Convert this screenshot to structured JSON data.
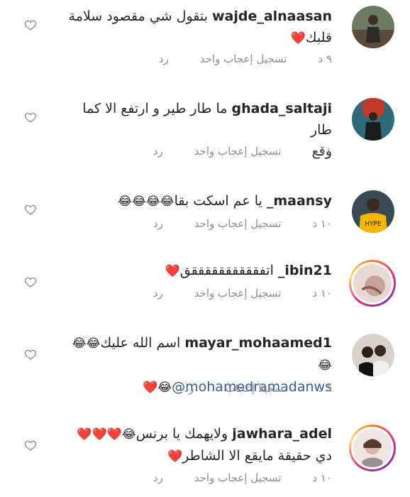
{
  "comments": [
    {
      "username": "wajde_alnaasan",
      "text": "بتقول شي مقصود سلامة",
      "text2": "قلبك",
      "emoji_after": "❤️",
      "time": "٩ د",
      "like_label": "تسجيل إعجاب واحد",
      "reply_label": "رد"
    },
    {
      "username": "ghada_saltaji",
      "text": "ما طار طير و ارتفع الا كما طار",
      "text2": "وقع",
      "time": "١١ د",
      "like_label": "تسجيل إعجاب واحد",
      "reply_label": "رد"
    },
    {
      "username": "maansy_",
      "text": "يا عم اسكت بقا",
      "emoji_after": "😂😂😂😂",
      "time": "١٠ د",
      "like_label": "تسجيل إعجاب واحد",
      "reply_label": "رد"
    },
    {
      "username": "ibin21_",
      "text": "اتفققققققققققق",
      "emoji_after": "❤️",
      "time": "١٠ د",
      "like_label": "تسجيل إعجاب واحد",
      "reply_label": "رد"
    },
    {
      "username": "mayar_mohaamed1",
      "text": "اسم الله عليك",
      "emoji_after": "😂😂😂",
      "mention": "@mohamedramadanws",
      "emoji_line2": "😂❤️",
      "time": "٩ د",
      "like_label": "تسجيلا إعجاب",
      "reply_label": "رد"
    },
    {
      "username": "jawhara_adel",
      "text": "ولايهمك يا برنس",
      "emoji_after": "😂❤️❤️❤️",
      "text2": "دي حقيقة مايقع الا الشاطر",
      "emoji_line2": "❤️",
      "time": "١٠ د",
      "like_label": "تسجيل إعجاب واحد",
      "reply_label": "رد"
    }
  ],
  "colors": {
    "text": "#262626",
    "meta": "#8e8e8e",
    "mention": "#385898",
    "heart_icon": "#8e8e8e",
    "red_heart": "#e0141e"
  }
}
